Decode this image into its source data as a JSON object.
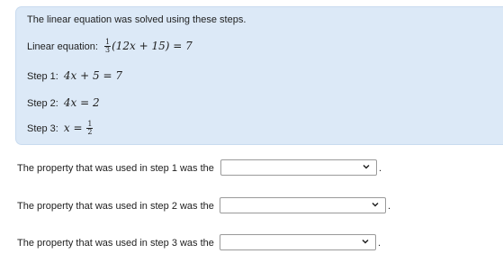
{
  "intro_text": "The linear equation was solved using these steps.",
  "equation": {
    "label": "Linear equation:",
    "frac_num": "1",
    "frac_den": "3",
    "expr": "(12x + 15) = 7"
  },
  "steps": [
    {
      "label": "Step 1:",
      "expr": "4x + 5 = 7"
    },
    {
      "label": "Step 2:",
      "expr": "4x = 2"
    },
    {
      "label": "Step 3:",
      "expr": "x = ",
      "frac_num": "1",
      "frac_den": "2"
    }
  ],
  "questions": [
    {
      "text": "The property that was used in step 1 was the",
      "selected": "",
      "suffix": "."
    },
    {
      "text": "The property that was used in step 2 was the",
      "selected": "",
      "suffix": "."
    },
    {
      "text": "The property that was used in step 3 was the",
      "selected": "",
      "suffix": "."
    }
  ],
  "colors": {
    "panel_bg": "#dce9f7",
    "panel_border": "#c9dbef",
    "select_border": "#9a9a9a",
    "text": "#1e1e1e"
  },
  "icons": {
    "dropdown": "chevron-down-icon"
  }
}
